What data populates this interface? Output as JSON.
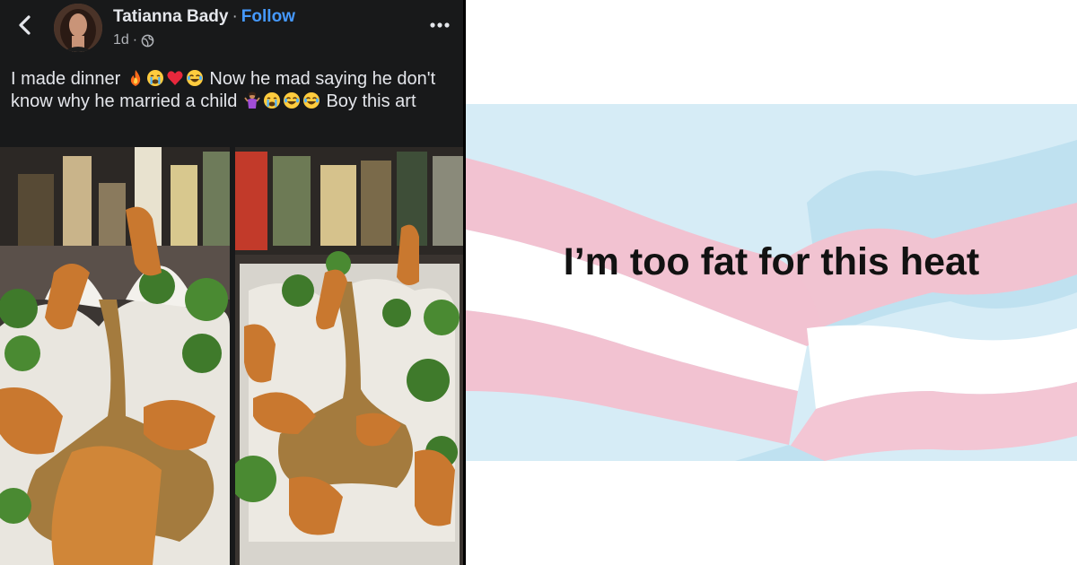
{
  "post": {
    "author": "Tatianna Bady",
    "separator": "·",
    "follow_label": "Follow",
    "time": "1d",
    "time_separator": "·",
    "caption_part1": "I made dinner",
    "caption_part2": "Now he mad saying he don't know why he married a child",
    "caption_part3": "Boy this art",
    "icons": {
      "back": "chevron-left-icon",
      "audience": "globe-icon",
      "more": "more-options-icon"
    },
    "caption_emojis_1": [
      "fire",
      "loudly-crying-face",
      "red-heart",
      "face-with-tears-of-joy"
    ],
    "caption_emojis_2": [
      "woman-shrugging",
      "loudly-crying-face",
      "face-with-tears-of-joy",
      "face-with-tears-of-joy"
    ]
  },
  "meme": {
    "text": "I’m too fat for this heat",
    "flag_colors": {
      "blue": "#b8dff2",
      "pink": "#f2bfd0",
      "white": "#ffffff"
    }
  },
  "colors": {
    "panel_bg": "#18191a",
    "text": "#e4e6eb",
    "subtext": "#b0b3b8",
    "link": "#4599ff"
  }
}
